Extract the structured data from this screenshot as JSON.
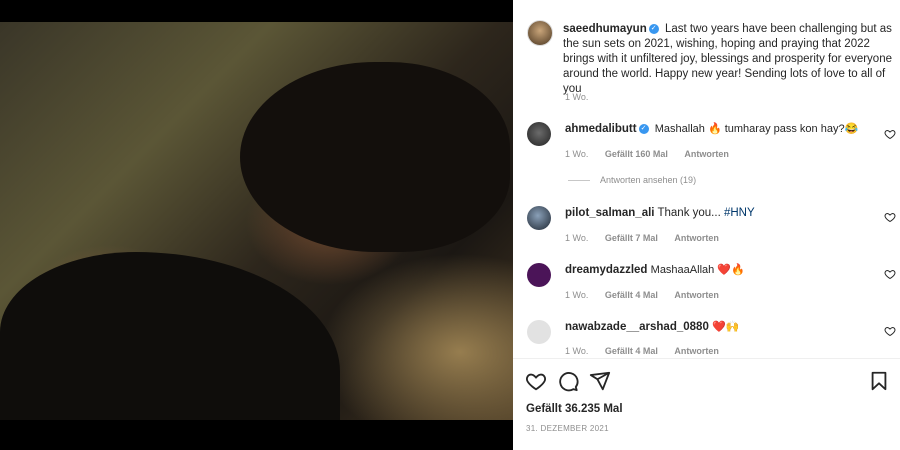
{
  "post": {
    "author": "saeedhumayun",
    "caption": "Last two years have been challenging but as the sun sets on 2021, wishing, hoping and praying that 2022 brings with it unfiltered joy, blessings and prosperity for everyone around the world. Happy new year! Sending lots of love to all of you",
    "caption_age": "1 Wo.",
    "likes": "Gefällt 36.235 Mal",
    "date": "31. DEZEMBER 2021"
  },
  "comments": [
    {
      "user": "ahmedalibutt",
      "verified": true,
      "text": "Mashallah 🔥 tumharay pass kon hay?😂",
      "age": "1 Wo.",
      "likes": "Gefällt 160 Mal",
      "reply": "Antworten"
    },
    {
      "user": "pilot_salman_ali",
      "text": "Thank you...",
      "hashtag": "#HNY",
      "age": "1 Wo.",
      "likes": "Gefällt 7 Mal",
      "reply": "Antworten"
    },
    {
      "user": "dreamydazzled",
      "text": "MashaaAllah ❤️🔥",
      "age": "1 Wo.",
      "likes": "Gefällt 4 Mal",
      "reply": "Antworten"
    },
    {
      "user": "nawabzade__arshad_0880",
      "text": "❤️🙌",
      "age": "1 Wo.",
      "likes": "Gefällt 4 Mal",
      "reply": "Antworten"
    }
  ],
  "view_replies": "Antworten ansehen (19)",
  "icons": [
    "heart-icon",
    "comment-icon",
    "share-icon",
    "bookmark-icon"
  ],
  "colors": {
    "verified": "#3897f0",
    "muted": "#8e8e8e",
    "text": "#262626"
  }
}
